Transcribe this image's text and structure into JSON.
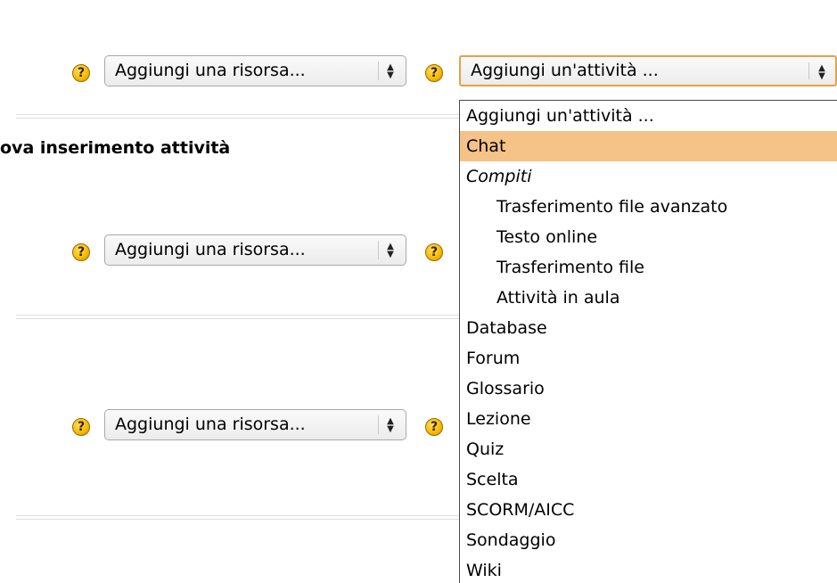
{
  "course_sections": [
    {
      "resource_select_value": "Aggiungi una risorsa...",
      "activity_select_value": "Aggiungi un'attività ..."
    },
    {
      "title": "ova inserimento attività",
      "resource_select_value": "Aggiungi una risorsa..."
    },
    {
      "resource_select_value": "Aggiungi una risorsa..."
    }
  ],
  "help_icon_glyph": "?",
  "activity_dropdown": {
    "highlight_color": "#f5c287",
    "options": [
      {
        "label": "Aggiungi un'attività ..."
      },
      {
        "label": "Chat",
        "selected": true
      },
      {
        "label": "Compiti",
        "group": true
      },
      {
        "label": "Trasferimento file avanzato",
        "child": true
      },
      {
        "label": "Testo online",
        "child": true
      },
      {
        "label": "Trasferimento file",
        "child": true
      },
      {
        "label": "Attività in aula",
        "child": true
      },
      {
        "label": "Database"
      },
      {
        "label": "Forum"
      },
      {
        "label": "Glossario"
      },
      {
        "label": "Lezione"
      },
      {
        "label": "Quiz"
      },
      {
        "label": "Scelta"
      },
      {
        "label": "SCORM/AICC"
      },
      {
        "label": "Sondaggio"
      },
      {
        "label": "Wiki"
      }
    ]
  }
}
